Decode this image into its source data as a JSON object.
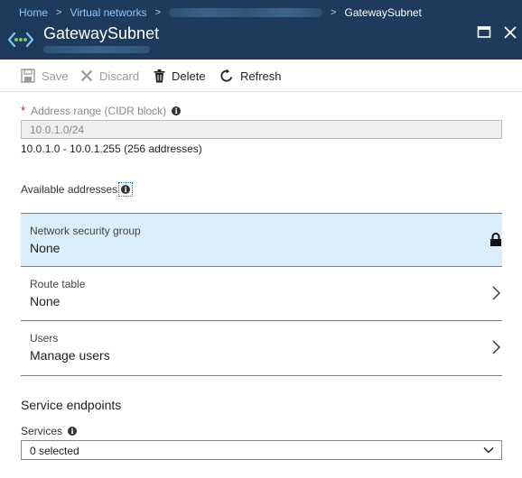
{
  "breadcrumb": {
    "home": "Home",
    "virtual_networks": "Virtual networks",
    "current": "GatewaySubnet"
  },
  "blade": {
    "title": "GatewaySubnet",
    "icon": "virtual-network-icon"
  },
  "toolbar": {
    "save_label": "Save",
    "discard_label": "Discard",
    "delete_label": "Delete",
    "refresh_label": "Refresh"
  },
  "address_range": {
    "label": "Address range (CIDR block)",
    "value": "10.0.1.0/24",
    "range_text": "10.0.1.0 - 10.0.1.255 (256 addresses)"
  },
  "available_addresses": {
    "label": "Available addresses"
  },
  "rows": {
    "nsg": {
      "label": "Network security group",
      "value": "None",
      "icon": "lock-icon"
    },
    "route_table": {
      "label": "Route table",
      "value": "None",
      "icon": "chevron-right-icon"
    },
    "users": {
      "label": "Users",
      "value": "Manage users",
      "icon": "chevron-right-icon"
    }
  },
  "service_endpoints": {
    "title": "Service endpoints",
    "services_label": "Services",
    "services_value": "0 selected"
  },
  "colors": {
    "header_bg": "#1e3a5c",
    "breadcrumb_link": "#8ec8ff",
    "selected_row_bg": "#dbeefb",
    "required_star": "#e00b1c"
  }
}
